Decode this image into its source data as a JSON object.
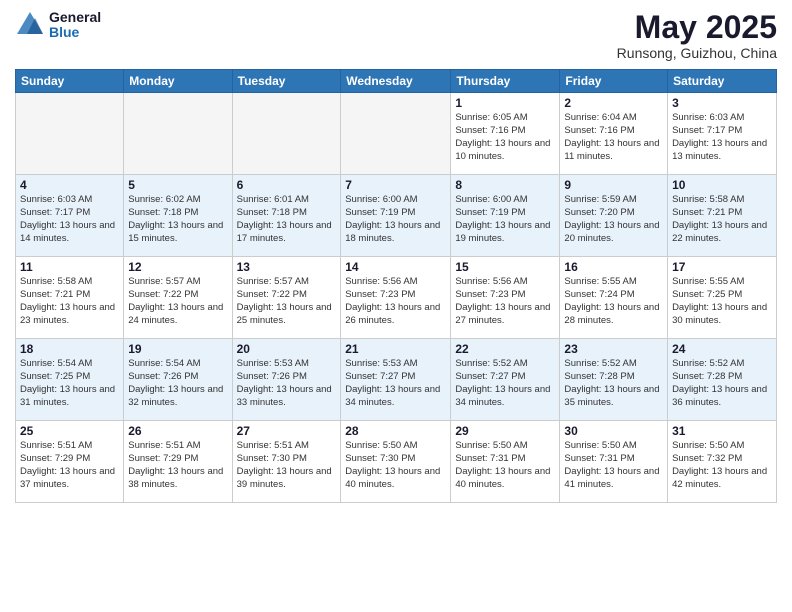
{
  "logo": {
    "general": "General",
    "blue": "Blue"
  },
  "title": "May 2025",
  "location": "Runsong, Guizhou, China",
  "days_of_week": [
    "Sunday",
    "Monday",
    "Tuesday",
    "Wednesday",
    "Thursday",
    "Friday",
    "Saturday"
  ],
  "weeks": [
    [
      {
        "day": "",
        "empty": true
      },
      {
        "day": "",
        "empty": true
      },
      {
        "day": "",
        "empty": true
      },
      {
        "day": "",
        "empty": true
      },
      {
        "day": "1",
        "sunrise": "6:05 AM",
        "sunset": "7:16 PM",
        "daylight": "13 hours and 10 minutes."
      },
      {
        "day": "2",
        "sunrise": "6:04 AM",
        "sunset": "7:16 PM",
        "daylight": "13 hours and 11 minutes."
      },
      {
        "day": "3",
        "sunrise": "6:03 AM",
        "sunset": "7:17 PM",
        "daylight": "13 hours and 13 minutes."
      }
    ],
    [
      {
        "day": "4",
        "sunrise": "6:03 AM",
        "sunset": "7:17 PM",
        "daylight": "13 hours and 14 minutes."
      },
      {
        "day": "5",
        "sunrise": "6:02 AM",
        "sunset": "7:18 PM",
        "daylight": "13 hours and 15 minutes."
      },
      {
        "day": "6",
        "sunrise": "6:01 AM",
        "sunset": "7:18 PM",
        "daylight": "13 hours and 17 minutes."
      },
      {
        "day": "7",
        "sunrise": "6:00 AM",
        "sunset": "7:19 PM",
        "daylight": "13 hours and 18 minutes."
      },
      {
        "day": "8",
        "sunrise": "6:00 AM",
        "sunset": "7:19 PM",
        "daylight": "13 hours and 19 minutes."
      },
      {
        "day": "9",
        "sunrise": "5:59 AM",
        "sunset": "7:20 PM",
        "daylight": "13 hours and 20 minutes."
      },
      {
        "day": "10",
        "sunrise": "5:58 AM",
        "sunset": "7:21 PM",
        "daylight": "13 hours and 22 minutes."
      }
    ],
    [
      {
        "day": "11",
        "sunrise": "5:58 AM",
        "sunset": "7:21 PM",
        "daylight": "13 hours and 23 minutes."
      },
      {
        "day": "12",
        "sunrise": "5:57 AM",
        "sunset": "7:22 PM",
        "daylight": "13 hours and 24 minutes."
      },
      {
        "day": "13",
        "sunrise": "5:57 AM",
        "sunset": "7:22 PM",
        "daylight": "13 hours and 25 minutes."
      },
      {
        "day": "14",
        "sunrise": "5:56 AM",
        "sunset": "7:23 PM",
        "daylight": "13 hours and 26 minutes."
      },
      {
        "day": "15",
        "sunrise": "5:56 AM",
        "sunset": "7:23 PM",
        "daylight": "13 hours and 27 minutes."
      },
      {
        "day": "16",
        "sunrise": "5:55 AM",
        "sunset": "7:24 PM",
        "daylight": "13 hours and 28 minutes."
      },
      {
        "day": "17",
        "sunrise": "5:55 AM",
        "sunset": "7:25 PM",
        "daylight": "13 hours and 30 minutes."
      }
    ],
    [
      {
        "day": "18",
        "sunrise": "5:54 AM",
        "sunset": "7:25 PM",
        "daylight": "13 hours and 31 minutes."
      },
      {
        "day": "19",
        "sunrise": "5:54 AM",
        "sunset": "7:26 PM",
        "daylight": "13 hours and 32 minutes."
      },
      {
        "day": "20",
        "sunrise": "5:53 AM",
        "sunset": "7:26 PM",
        "daylight": "13 hours and 33 minutes."
      },
      {
        "day": "21",
        "sunrise": "5:53 AM",
        "sunset": "7:27 PM",
        "daylight": "13 hours and 34 minutes."
      },
      {
        "day": "22",
        "sunrise": "5:52 AM",
        "sunset": "7:27 PM",
        "daylight": "13 hours and 34 minutes."
      },
      {
        "day": "23",
        "sunrise": "5:52 AM",
        "sunset": "7:28 PM",
        "daylight": "13 hours and 35 minutes."
      },
      {
        "day": "24",
        "sunrise": "5:52 AM",
        "sunset": "7:28 PM",
        "daylight": "13 hours and 36 minutes."
      }
    ],
    [
      {
        "day": "25",
        "sunrise": "5:51 AM",
        "sunset": "7:29 PM",
        "daylight": "13 hours and 37 minutes."
      },
      {
        "day": "26",
        "sunrise": "5:51 AM",
        "sunset": "7:29 PM",
        "daylight": "13 hours and 38 minutes."
      },
      {
        "day": "27",
        "sunrise": "5:51 AM",
        "sunset": "7:30 PM",
        "daylight": "13 hours and 39 minutes."
      },
      {
        "day": "28",
        "sunrise": "5:50 AM",
        "sunset": "7:30 PM",
        "daylight": "13 hours and 40 minutes."
      },
      {
        "day": "29",
        "sunrise": "5:50 AM",
        "sunset": "7:31 PM",
        "daylight": "13 hours and 40 minutes."
      },
      {
        "day": "30",
        "sunrise": "5:50 AM",
        "sunset": "7:31 PM",
        "daylight": "13 hours and 41 minutes."
      },
      {
        "day": "31",
        "sunrise": "5:50 AM",
        "sunset": "7:32 PM",
        "daylight": "13 hours and 42 minutes."
      }
    ]
  ]
}
